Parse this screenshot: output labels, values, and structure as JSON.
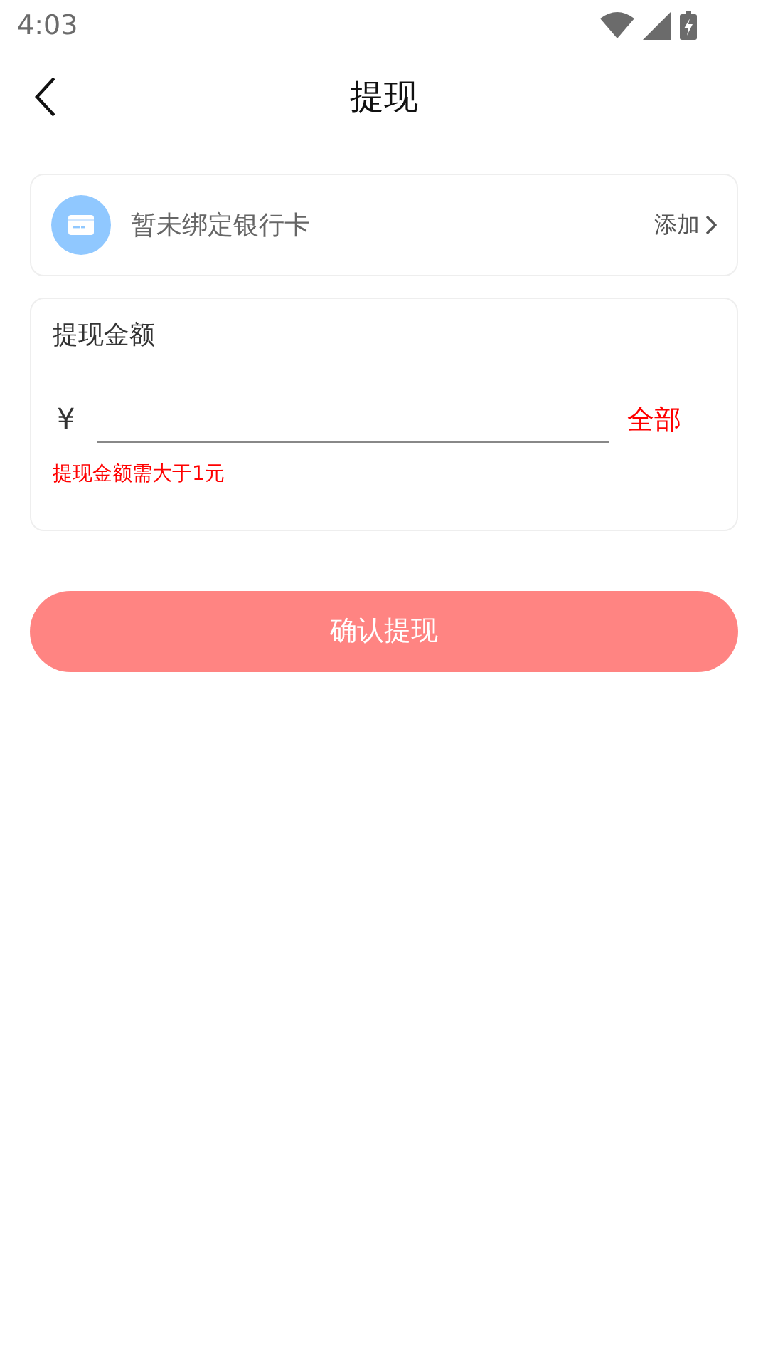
{
  "status_bar": {
    "time": "4:03"
  },
  "header": {
    "title": "提现"
  },
  "bank_card": {
    "text": "暂未绑定银行卡",
    "action": "添加"
  },
  "amount": {
    "label": "提现金额",
    "currency": "¥",
    "all": "全部",
    "error": "提现金额需大于1元"
  },
  "confirm_button": {
    "label": "确认提现",
    "disabled": true
  }
}
